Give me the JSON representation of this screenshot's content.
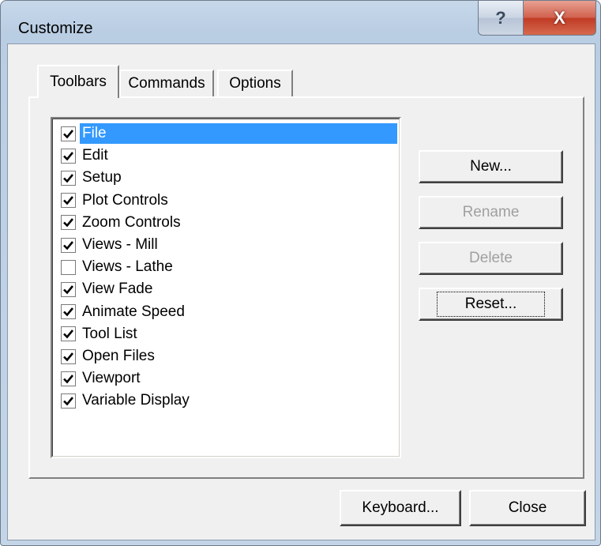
{
  "window": {
    "title": "Customize",
    "help_glyph": "?",
    "close_glyph": "X"
  },
  "tabs": [
    {
      "label": "Toolbars",
      "active": true
    },
    {
      "label": "Commands",
      "active": false
    },
    {
      "label": "Options",
      "active": false
    }
  ],
  "toolbar_list": {
    "items": [
      {
        "label": "File",
        "checked": true,
        "selected": true
      },
      {
        "label": "Edit",
        "checked": true,
        "selected": false
      },
      {
        "label": "Setup",
        "checked": true,
        "selected": false
      },
      {
        "label": "Plot Controls",
        "checked": true,
        "selected": false
      },
      {
        "label": "Zoom Controls",
        "checked": true,
        "selected": false
      },
      {
        "label": "Views - Mill",
        "checked": true,
        "selected": false
      },
      {
        "label": "Views - Lathe",
        "checked": false,
        "selected": false
      },
      {
        "label": "View Fade",
        "checked": true,
        "selected": false
      },
      {
        "label": "Animate Speed",
        "checked": true,
        "selected": false
      },
      {
        "label": "Tool List",
        "checked": true,
        "selected": false
      },
      {
        "label": "Open Files",
        "checked": true,
        "selected": false
      },
      {
        "label": "Viewport",
        "checked": true,
        "selected": false
      },
      {
        "label": "Variable Display",
        "checked": true,
        "selected": false
      }
    ]
  },
  "side_buttons": {
    "new": "New...",
    "rename": "Rename",
    "delete": "Delete",
    "reset": "Reset..."
  },
  "footer_buttons": {
    "keyboard": "Keyboard...",
    "close": "Close"
  },
  "colors": {
    "selection": "#3399ff",
    "disabled_text": "#a0a0a0",
    "close_button": "#c8472f"
  }
}
